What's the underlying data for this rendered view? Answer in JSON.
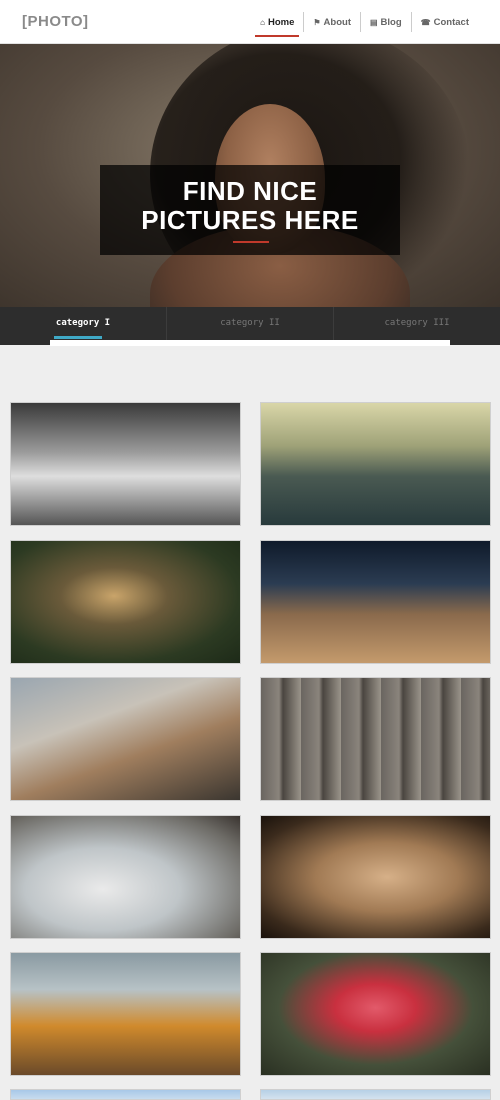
{
  "navbar": {
    "brand": "[PHOTO]",
    "items": [
      {
        "label": "Home",
        "icon": "home-icon",
        "active": true
      },
      {
        "label": "About",
        "icon": "bookmark-icon",
        "active": false
      },
      {
        "label": "Blog",
        "icon": "document-icon",
        "active": false
      },
      {
        "label": "Contact",
        "icon": "phone-icon",
        "active": false
      }
    ]
  },
  "hero": {
    "title_line1": "FIND NICE",
    "title_line2": "PICTURES HERE"
  },
  "categories": [
    {
      "label": "category I",
      "active": true
    },
    {
      "label": "category II",
      "active": false
    },
    {
      "label": "category III",
      "active": false
    }
  ],
  "gallery": [
    {
      "subject": "ballroom dancers"
    },
    {
      "subject": "child in paper boat"
    },
    {
      "subject": "crowned cranes"
    },
    {
      "subject": "camel in desert"
    },
    {
      "subject": "woman on rail track"
    },
    {
      "subject": "wooden heart with leaves"
    },
    {
      "subject": "christmas gnome in snow"
    },
    {
      "subject": "two girls portrait"
    },
    {
      "subject": "halloween pumpkins"
    },
    {
      "subject": "red rose"
    },
    {
      "subject": "sky"
    },
    {
      "subject": "sky"
    }
  ],
  "colors": {
    "accent_red": "#c0392b",
    "accent_blue": "#3fa9c6",
    "category_bar": "#2d2d2d",
    "page_background": "#eeeeee"
  }
}
